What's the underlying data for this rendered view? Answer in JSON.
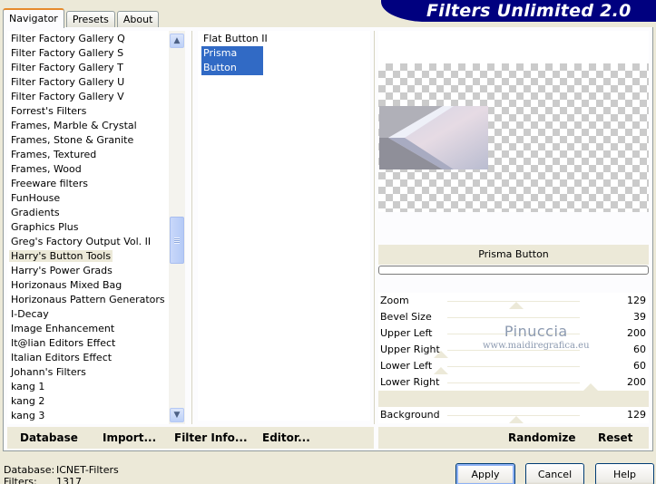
{
  "app": {
    "title": "Filters Unlimited 2.0",
    "tabs": [
      "Navigator",
      "Presets",
      "About"
    ]
  },
  "categories": [
    "Filter Factory Gallery Q",
    "Filter Factory Gallery S",
    "Filter Factory Gallery T",
    "Filter Factory Gallery U",
    "Filter Factory Gallery V",
    "Forrest's Filters",
    "Frames, Marble & Crystal",
    "Frames, Stone & Granite",
    "Frames, Textured",
    "Frames, Wood",
    "Freeware filters",
    "FunHouse",
    "Gradients",
    "Graphics Plus",
    "Greg's Factory Output Vol. II",
    "Harry's Button Tools",
    "Harry's Power Grads",
    "Horizonaus Mixed Bag",
    "Horizonaus Pattern Generators",
    "I-Decay",
    "Image Enhancement",
    "It@lian Editors Effect",
    "Italian Editors Effect",
    "Johann's Filters",
    "kang 1",
    "kang 2",
    "kang 3"
  ],
  "selected_category": "Harry's Button Tools",
  "filters": [
    "Flat Button II",
    "Prisma Button"
  ],
  "selected_filter": "Prisma Button",
  "preview": {
    "filter_name": "Prisma Button"
  },
  "parameters": [
    {
      "label": "Zoom",
      "value": "129"
    },
    {
      "label": "Bevel Size",
      "value": "39"
    },
    {
      "label": "Upper Left",
      "value": "200"
    },
    {
      "label": "Upper Right",
      "value": "60"
    },
    {
      "label": "Lower Left",
      "value": "60"
    },
    {
      "label": "Lower Right",
      "value": "200"
    },
    {
      "label": "",
      "value": ""
    },
    {
      "label": "Background",
      "value": "129"
    }
  ],
  "watermark": {
    "name": "Pinuccia",
    "url": "www.maidiregrafica.eu"
  },
  "toolbar": {
    "database": "Database",
    "import": "Import...",
    "filter_info": "Filter Info...",
    "editor": "Editor...",
    "randomize": "Randomize",
    "reset": "Reset"
  },
  "status": {
    "database_label": "Database:",
    "database_value": "ICNET-Filters",
    "filters_label": "Filters:",
    "filters_value": "1317"
  },
  "buttons": {
    "apply": "Apply",
    "cancel": "Cancel",
    "help": "Help"
  },
  "colors": {
    "banner": "#00007f",
    "selection": "#316ac5",
    "dialog_bg": "#ece9d8"
  }
}
